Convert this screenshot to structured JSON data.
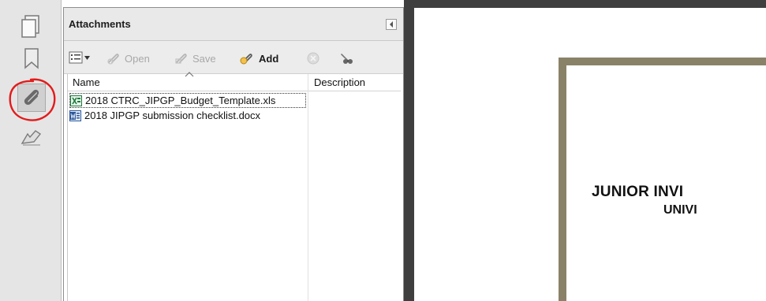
{
  "panel": {
    "title": "Attachments"
  },
  "toolbar": {
    "open_label": "Open",
    "save_label": "Save",
    "add_label": "Add"
  },
  "table": {
    "columns": {
      "name": "Name",
      "description": "Description"
    },
    "rows": [
      {
        "name": "2018 CTRC_JIPGP_Budget_Template.xls",
        "type": "excel"
      },
      {
        "name": "2018 JIPGP submission checklist.docx",
        "type": "word"
      }
    ]
  },
  "document": {
    "line1": "JUNIOR INVI",
    "line2": "UNIVI"
  },
  "colors": {
    "frame": "#8a8268",
    "annotation": "#e31b1b",
    "dark_bg": "#3f3f3f"
  }
}
